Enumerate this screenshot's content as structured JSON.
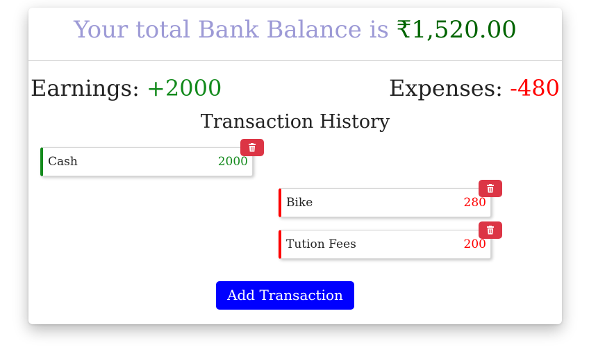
{
  "balance": {
    "label": "Your total Bank Balance is ",
    "amount": "₹1,520.00"
  },
  "summary": {
    "earnings_label": "Earnings: ",
    "earnings_value": "+2000",
    "expenses_label": "Expenses: ",
    "expenses_value": "-480"
  },
  "history": {
    "title": "Transaction History",
    "transactions": [
      {
        "name": "Cash",
        "amount": "2000",
        "type": "income"
      },
      {
        "name": "Bike",
        "amount": "280",
        "type": "expense"
      },
      {
        "name": "Tution Fees",
        "amount": "200",
        "type": "expense"
      }
    ]
  },
  "actions": {
    "add_label": "Add Transaction"
  },
  "colors": {
    "title": "#9d9ad6",
    "balance": "#006400",
    "income": "#138a1c",
    "expense": "#ff0000",
    "delete_button": "#dc3545",
    "add_button": "#0000ff"
  },
  "icons": {
    "delete": "trash-icon"
  }
}
